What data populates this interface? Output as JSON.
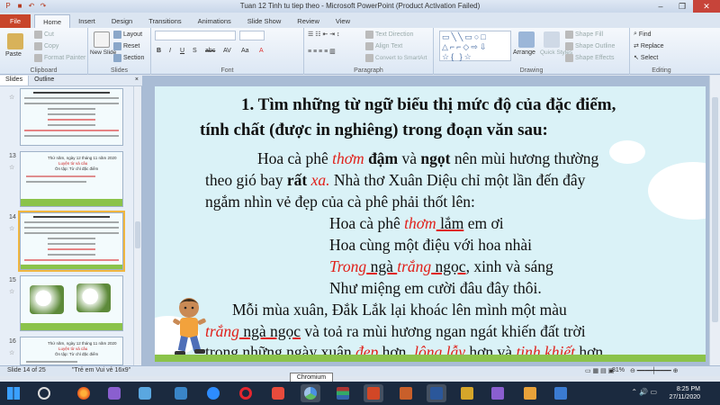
{
  "window": {
    "title": "Tuan 12 Tinh tu tiep theo - Microsoft PowerPoint (Product Activation Failed)",
    "qat": [
      "save-icon",
      "undo-icon",
      "redo-icon"
    ],
    "controls": [
      "–",
      "❐",
      "✕"
    ]
  },
  "ribbon_tabs": [
    "File",
    "Home",
    "Insert",
    "Design",
    "Transitions",
    "Animations",
    "Slide Show",
    "Review",
    "View"
  ],
  "ribbon": {
    "clipboard": {
      "paste": "Paste",
      "cut": "Cut",
      "copy": "Copy",
      "format_painter": "Format Painter",
      "label": "Clipboard"
    },
    "slides": {
      "new_slide": "New Slide",
      "layout": "Layout",
      "reset": "Reset",
      "section": "Section",
      "label": "Slides"
    },
    "font": {
      "label": "Font"
    },
    "paragraph": {
      "text_direction": "Text Direction",
      "align_text": "Align Text",
      "convert_smartart": "Convert to SmartArt",
      "label": "Paragraph"
    },
    "drawing": {
      "arrange": "Arrange",
      "quick_styles": "Quick Styles",
      "shape_fill": "Shape Fill",
      "shape_outline": "Shape Outline",
      "shape_effects": "Shape Effects",
      "label": "Drawing"
    },
    "editing": {
      "find": "Find",
      "replace": "Replace",
      "select": "Select",
      "label": "Editing"
    }
  },
  "panel": {
    "tab_slides": "Slides",
    "tab_outline": "Outline",
    "close": "×"
  },
  "thumbnails": [
    {
      "num": "",
      "kind": "text"
    },
    {
      "num": "13",
      "kind": "title"
    },
    {
      "num": "14",
      "kind": "text",
      "selected": true
    },
    {
      "num": "15",
      "kind": "flowers"
    },
    {
      "num": "16",
      "kind": "title"
    }
  ],
  "thumb_text": {
    "t13_a": "Thứ năm, ngày 12 tháng 11 năm 2020",
    "t13_b": "Luyện từ và câu",
    "t13_c": "Ôn tập: Từ chỉ đặc điểm",
    "t16_a": "Thứ năm, ngày 12 tháng 11 năm 2020",
    "t16_b": "Luyện từ và câu",
    "t16_c": "Ôn tập: Từ chỉ đặc điểm"
  },
  "slide": {
    "heading_1": "1. Tìm những từ ngữ biểu thị mức độ của đặc điểm,",
    "heading_2": "tính chất (được in nghiêng) trong đoạn văn sau:",
    "p1_a": "Hoa cà phê ",
    "p1_b": "thơm",
    "p1_c": " đậm",
    "p1_d": " và ",
    "p1_e": "ngọt",
    "p1_f": " nên mùi hương thường",
    "p2_a": "theo gió bay ",
    "p2_b": "rất",
    "p2_c": " xa.",
    "p2_d": " Nhà thơ Xuân Diệu chỉ một lần đến đây",
    "p3": "ngắm nhìn vẻ đẹp của cà phê phải thốt lên:",
    "v1_a": "Hoa cà phê ",
    "v1_b": "thơm",
    "v1_c": " lắm",
    "v1_d": " em ơi",
    "v2": "Hoa cùng một điệu với hoa nhài",
    "v3_a": "Trong",
    "v3_b": " ngà ",
    "v3_c": "trắng",
    "v3_d": " ngọc",
    "v3_e": ", xinh và sáng",
    "v4": "Như miệng em cười đâu đây thôi.",
    "p4": "Mỗi mùa xuân, Đắk Lắk lại khoác lên mình một màu",
    "p5_a": "trắng",
    "p5_b": " ngà ngọc",
    "p5_c": " và toả ra mùi hương ngan ngát khiến đất trời",
    "p6_a": "trong những ngày xuân ",
    "p6_b": "đẹp",
    "p6_c": " hơn",
    "p6_d": ", ",
    "p6_e": "lộng lẫy",
    "p6_f": " hơn",
    "p6_g": " và ",
    "p6_h": "tinh khiết",
    "p6_i": " hơn."
  },
  "status": {
    "slide_of": "Slide 14 of 25",
    "theme": "\"Trẻ em Vui vẻ 16x9\"",
    "zoom": "81%"
  },
  "tooltip": "Chromium",
  "clock": {
    "time": "8:25 PM",
    "date": "27/11/2020"
  },
  "tray": "⌃ 🔊 ▭"
}
